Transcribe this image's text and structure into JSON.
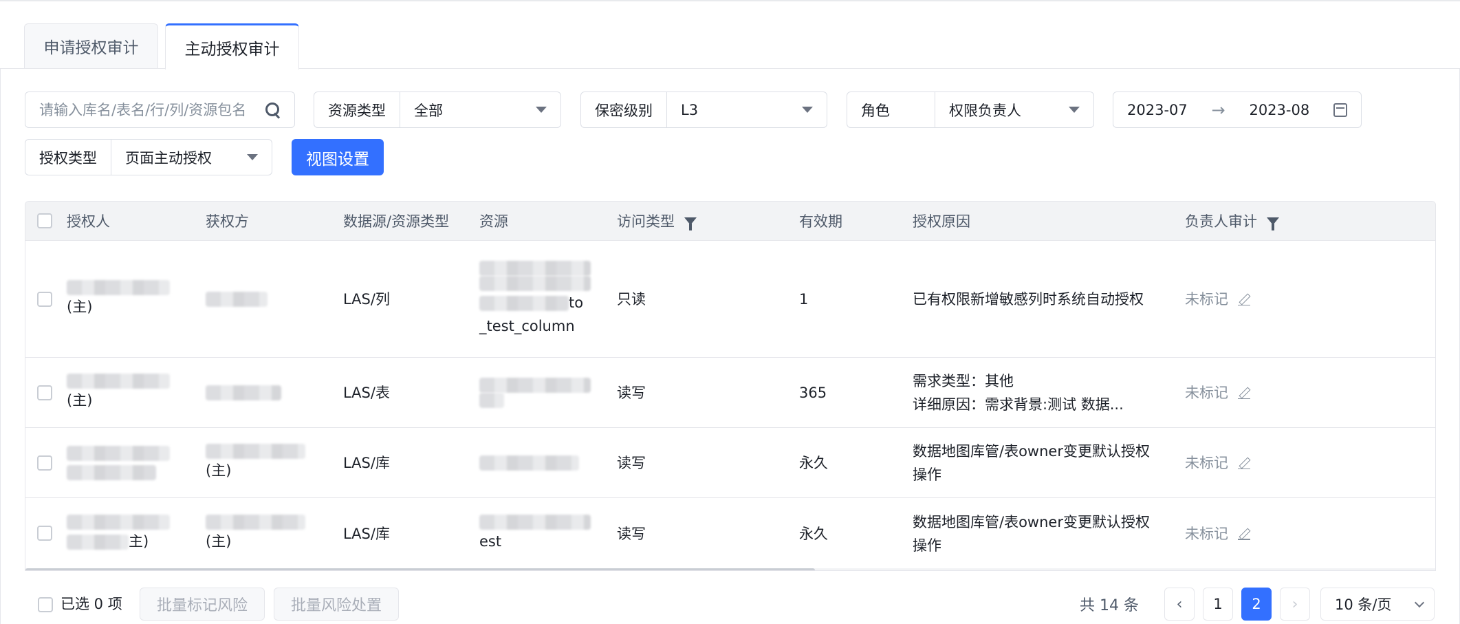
{
  "tabs": [
    {
      "label": "申请授权审计",
      "active": false
    },
    {
      "label": "主动授权审计",
      "active": true
    }
  ],
  "filters": {
    "search_placeholder": "请输入库名/表名/行/列/资源包名",
    "resource_type": {
      "label": "资源类型",
      "value": "全部"
    },
    "secret_level": {
      "label": "保密级别",
      "value": "L3"
    },
    "role": {
      "label": "角色",
      "value": "权限负责人"
    },
    "date_range": {
      "start": "2023-07",
      "arrow": "→",
      "end": "2023-08"
    },
    "auth_type": {
      "label": "授权类型",
      "value": "页面主动授权"
    },
    "view_settings_label": "视图设置"
  },
  "table": {
    "columns": [
      "授权人",
      "获权方",
      "数据源/资源类型",
      "资源",
      "访问类型",
      "有效期",
      "授权原因",
      "负责人审计"
    ],
    "rows": [
      {
        "grantor_tail": "(主)",
        "grantee_tail": "",
        "source": "LAS/列",
        "resource_line2": "",
        "resource_line3_tail": "to",
        "resource_line4": "_test_column",
        "access": "只读",
        "validity": "1",
        "reason": [
          "已有权限新增敏感列时系统自动授权"
        ],
        "audit": "未标记"
      },
      {
        "grantor_tail": "(主)",
        "grantee_tail": "",
        "source": "LAS/表",
        "resource_line2": "",
        "resource_line3_tail": "",
        "resource_line4": "",
        "access": "读写",
        "validity": "365",
        "reason": [
          "需求类型：其他",
          "详细原因：需求背景:测试 数据..."
        ],
        "audit": "未标记"
      },
      {
        "grantor_tail": "",
        "grantee_tail": "(主)",
        "source": "LAS/库",
        "resource_line2": "",
        "resource_line3_tail": "",
        "resource_line4": "",
        "access": "读写",
        "validity": "永久",
        "reason": [
          "数据地图库管/表owner变更默认授权",
          "操作"
        ],
        "audit": "未标记"
      },
      {
        "grantor_tail": "主)",
        "grantee_tail": "(主)",
        "source": "LAS/库",
        "resource_line2": "est",
        "resource_line3_tail": "",
        "resource_line4": "",
        "access": "读写",
        "validity": "永久",
        "reason": [
          "数据地图库管/表owner变更默认授权",
          "操作"
        ],
        "audit": "未标记"
      }
    ]
  },
  "footer": {
    "selected_label": "已选 0 项",
    "batch_mark_label": "批量标记风险",
    "batch_handle_label": "批量风险处置",
    "total_label": "共 14 条",
    "pages": [
      "1",
      "2"
    ],
    "current_page": "2",
    "prev_icon": "chevron-left-icon",
    "next_icon": "chevron-right-icon",
    "page_size_label": "10 条/页"
  },
  "colors": {
    "accent": "#3370ff",
    "muted_text": "#86909c",
    "border": "#e5e6eb",
    "header_bg": "#f2f3f5"
  }
}
